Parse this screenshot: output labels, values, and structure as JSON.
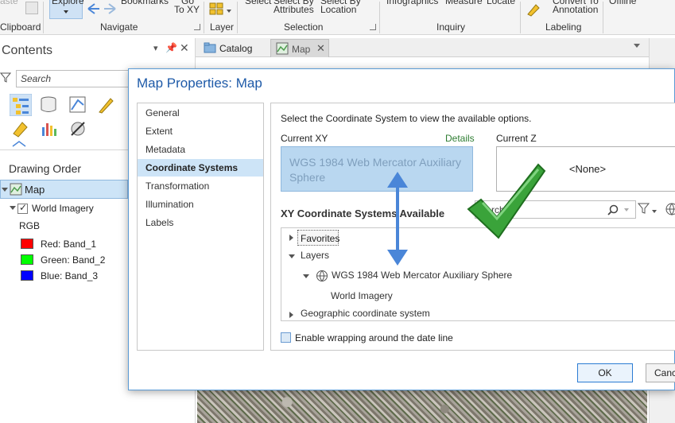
{
  "ribbon": {
    "clipboard_top": "aste",
    "clipboard_label": "Clipboard",
    "explore_label": "Explore",
    "bookmarks_label": "Bookmarks",
    "goto_label_top": "Go",
    "goto_label": "To XY",
    "navigate_label": "Navigate",
    "layer_label": "Layer",
    "select_label": "Select",
    "select_by_attr_top": "Select By",
    "select_by_attr": "Attributes",
    "select_by_loc_top": "Select By",
    "select_by_loc": "Location",
    "selection_label": "Selection",
    "infographics_label": "Infographics",
    "measure_label": "Measure",
    "locate_label": "Locate",
    "inquiry_label": "Inquiry",
    "convert_top": "Convert To",
    "convert_label": "Annotation",
    "labeling_label": "Labeling",
    "offline_label": "Offline"
  },
  "contents": {
    "title": "Contents",
    "search_placeholder": "Search",
    "drawing_order": "Drawing Order",
    "map_item": "Map",
    "world_imagery": "World Imagery",
    "rgb": "RGB",
    "bands": [
      {
        "label": "Red:  Band_1",
        "color": "#ff0000"
      },
      {
        "label": "Green: Band_2",
        "color": "#00ff00"
      },
      {
        "label": "Blue:  Band_3",
        "color": "#0000ff"
      }
    ]
  },
  "tabs": {
    "catalog": "Catalog",
    "map": "Map"
  },
  "dialog": {
    "title": "Map Properties: Map",
    "nav": [
      "General",
      "Extent",
      "Metadata",
      "Coordinate Systems",
      "Transformation",
      "Illumination",
      "Labels"
    ],
    "active_nav": "Coordinate Systems",
    "instructions": "Select the Coordinate System to view the available options.",
    "current_xy_label": "Current XY",
    "details_link": "Details",
    "current_xy_value": "WGS 1984 Web Mercator Auxiliary Sphere",
    "current_z_label": "Current Z",
    "current_z_value": "<None>",
    "xy_available_heading": "XY Coordinate Systems Available",
    "filter_partial_text": "rch",
    "tree": {
      "favorites": "Favorites",
      "layers": "Layers",
      "wgs_item": "WGS 1984 Web Mercator Auxiliary Sphere",
      "world_imagery": "World Imagery",
      "geographic": "Geographic coordinate system"
    },
    "wrap_label": "Enable wrapping around the date line",
    "ok_label": "OK",
    "cancel_label": "Canc"
  },
  "colors": {
    "accent_blue": "#1e5aa8",
    "arrow_blue": "#4a86d8",
    "check_green": "#3aa33a",
    "active_nav_bg": "#cde4f7"
  }
}
